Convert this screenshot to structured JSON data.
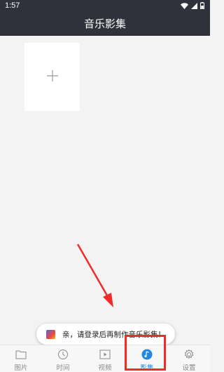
{
  "status_bar": {
    "time": "1:57",
    "icons": [
      "wifi-icon",
      "signal-icon",
      "battery-icon"
    ]
  },
  "header": {
    "title": "音乐影集"
  },
  "main": {
    "add_tile": {
      "icon": "plus-icon"
    }
  },
  "toast": {
    "message": "亲，请登录后再制作音乐影集！",
    "icon": "app-icon"
  },
  "tabs": [
    {
      "label": "图片",
      "icon": "folder-icon"
    },
    {
      "label": "时间",
      "icon": "clock-icon"
    },
    {
      "label": "视频",
      "icon": "video-icon"
    },
    {
      "label": "影集",
      "icon": "music-note-icon",
      "active": true
    },
    {
      "label": "设置",
      "icon": "gear-icon"
    }
  ],
  "colors": {
    "header_bg": "#2f323a",
    "accent": "#1e88e5",
    "annotation_red": "#ef2b2b"
  }
}
